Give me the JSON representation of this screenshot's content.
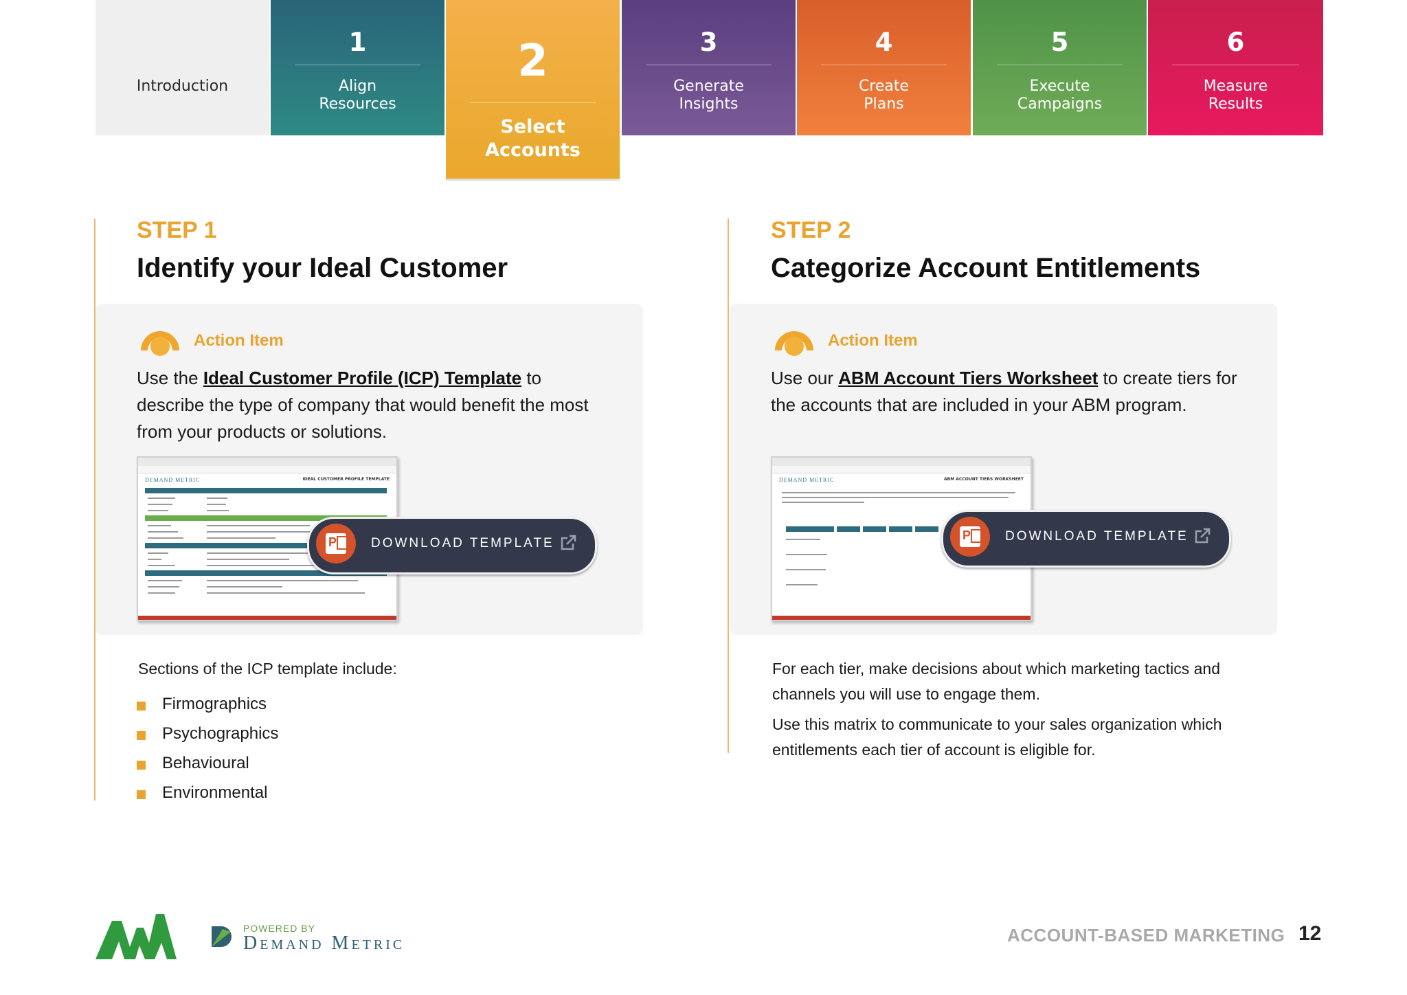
{
  "tabs": [
    {
      "num": "",
      "label": "Introduction"
    },
    {
      "num": "1",
      "label": "Align\nResources"
    },
    {
      "num": "2",
      "label": "Select\nAccounts"
    },
    {
      "num": "3",
      "label": "Generate\nInsights"
    },
    {
      "num": "4",
      "label": "Create\nPlans"
    },
    {
      "num": "5",
      "label": "Execute\nCampaigns"
    },
    {
      "num": "6",
      "label": "Measure\nResults"
    }
  ],
  "step1": {
    "kicker": "STEP 1",
    "title": "Identify your Ideal Customer",
    "action_label": "Action Item",
    "text_before": "Use the ",
    "link": "Ideal Customer Profile (ICP) Template",
    "text_after": " to describe the type of company that would benefit the most from your products or solutions.",
    "thumb_brand": "DEMAND METRIC",
    "thumb_title": "IDEAL CUSTOMER PROFILE TEMPLATE",
    "download_label": "DOWNLOAD TEMPLATE",
    "sections_intro": "Sections of the ICP template include:",
    "sections": [
      "Firmographics",
      "Psychographics",
      "Behavioural",
      "Environmental"
    ]
  },
  "step2": {
    "kicker": "STEP 2",
    "title": "Categorize Account Entitlements",
    "action_label": "Action Item",
    "text_before": "Use our ",
    "link": "ABM Account Tiers Worksheet",
    "text_after": " to create tiers for the accounts that are included in your ABM program.",
    "thumb_brand": "DEMAND METRIC",
    "thumb_title": "ABM ACCOUNT TIERS WORKSHEET",
    "download_label": "DOWNLOAD TEMPLATE",
    "para1": "For each tier, make decisions about which marketing tactics and channels you will use to engage them.",
    "para2": "Use this matrix to communicate to your sales organization which entitlements each tier of account is eligible for."
  },
  "footer": {
    "powered_by": "POWERED BY",
    "brand": "Demand Metric",
    "title": "ACCOUNT-BASED MARKETING",
    "page": "12"
  },
  "colors": {
    "accent": "#e8a42e",
    "step1": "#2e8a84",
    "step2": "#e8a92c",
    "step3": "#7b5a98",
    "step4": "#f1803d",
    "step5": "#70ac57",
    "step6": "#e8195f"
  },
  "icons": [
    "action-item-icon",
    "powerpoint-icon",
    "external-link-icon",
    "ana-logo",
    "demand-metric-logo"
  ]
}
